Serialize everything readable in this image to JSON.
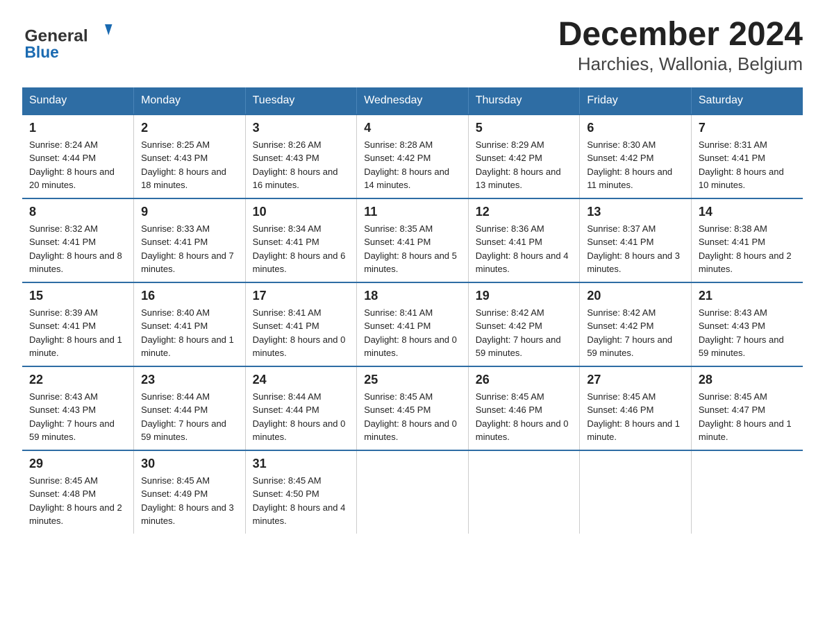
{
  "logo": {
    "general": "General",
    "blue": "Blue"
  },
  "title": "December 2024",
  "subtitle": "Harchies, Wallonia, Belgium",
  "days_of_week": [
    "Sunday",
    "Monday",
    "Tuesday",
    "Wednesday",
    "Thursday",
    "Friday",
    "Saturday"
  ],
  "weeks": [
    [
      {
        "day": "1",
        "sunrise": "8:24 AM",
        "sunset": "4:44 PM",
        "daylight": "8 hours and 20 minutes."
      },
      {
        "day": "2",
        "sunrise": "8:25 AM",
        "sunset": "4:43 PM",
        "daylight": "8 hours and 18 minutes."
      },
      {
        "day": "3",
        "sunrise": "8:26 AM",
        "sunset": "4:43 PM",
        "daylight": "8 hours and 16 minutes."
      },
      {
        "day": "4",
        "sunrise": "8:28 AM",
        "sunset": "4:42 PM",
        "daylight": "8 hours and 14 minutes."
      },
      {
        "day": "5",
        "sunrise": "8:29 AM",
        "sunset": "4:42 PM",
        "daylight": "8 hours and 13 minutes."
      },
      {
        "day": "6",
        "sunrise": "8:30 AM",
        "sunset": "4:42 PM",
        "daylight": "8 hours and 11 minutes."
      },
      {
        "day": "7",
        "sunrise": "8:31 AM",
        "sunset": "4:41 PM",
        "daylight": "8 hours and 10 minutes."
      }
    ],
    [
      {
        "day": "8",
        "sunrise": "8:32 AM",
        "sunset": "4:41 PM",
        "daylight": "8 hours and 8 minutes."
      },
      {
        "day": "9",
        "sunrise": "8:33 AM",
        "sunset": "4:41 PM",
        "daylight": "8 hours and 7 minutes."
      },
      {
        "day": "10",
        "sunrise": "8:34 AM",
        "sunset": "4:41 PM",
        "daylight": "8 hours and 6 minutes."
      },
      {
        "day": "11",
        "sunrise": "8:35 AM",
        "sunset": "4:41 PM",
        "daylight": "8 hours and 5 minutes."
      },
      {
        "day": "12",
        "sunrise": "8:36 AM",
        "sunset": "4:41 PM",
        "daylight": "8 hours and 4 minutes."
      },
      {
        "day": "13",
        "sunrise": "8:37 AM",
        "sunset": "4:41 PM",
        "daylight": "8 hours and 3 minutes."
      },
      {
        "day": "14",
        "sunrise": "8:38 AM",
        "sunset": "4:41 PM",
        "daylight": "8 hours and 2 minutes."
      }
    ],
    [
      {
        "day": "15",
        "sunrise": "8:39 AM",
        "sunset": "4:41 PM",
        "daylight": "8 hours and 1 minute."
      },
      {
        "day": "16",
        "sunrise": "8:40 AM",
        "sunset": "4:41 PM",
        "daylight": "8 hours and 1 minute."
      },
      {
        "day": "17",
        "sunrise": "8:41 AM",
        "sunset": "4:41 PM",
        "daylight": "8 hours and 0 minutes."
      },
      {
        "day": "18",
        "sunrise": "8:41 AM",
        "sunset": "4:41 PM",
        "daylight": "8 hours and 0 minutes."
      },
      {
        "day": "19",
        "sunrise": "8:42 AM",
        "sunset": "4:42 PM",
        "daylight": "7 hours and 59 minutes."
      },
      {
        "day": "20",
        "sunrise": "8:42 AM",
        "sunset": "4:42 PM",
        "daylight": "7 hours and 59 minutes."
      },
      {
        "day": "21",
        "sunrise": "8:43 AM",
        "sunset": "4:43 PM",
        "daylight": "7 hours and 59 minutes."
      }
    ],
    [
      {
        "day": "22",
        "sunrise": "8:43 AM",
        "sunset": "4:43 PM",
        "daylight": "7 hours and 59 minutes."
      },
      {
        "day": "23",
        "sunrise": "8:44 AM",
        "sunset": "4:44 PM",
        "daylight": "7 hours and 59 minutes."
      },
      {
        "day": "24",
        "sunrise": "8:44 AM",
        "sunset": "4:44 PM",
        "daylight": "8 hours and 0 minutes."
      },
      {
        "day": "25",
        "sunrise": "8:45 AM",
        "sunset": "4:45 PM",
        "daylight": "8 hours and 0 minutes."
      },
      {
        "day": "26",
        "sunrise": "8:45 AM",
        "sunset": "4:46 PM",
        "daylight": "8 hours and 0 minutes."
      },
      {
        "day": "27",
        "sunrise": "8:45 AM",
        "sunset": "4:46 PM",
        "daylight": "8 hours and 1 minute."
      },
      {
        "day": "28",
        "sunrise": "8:45 AM",
        "sunset": "4:47 PM",
        "daylight": "8 hours and 1 minute."
      }
    ],
    [
      {
        "day": "29",
        "sunrise": "8:45 AM",
        "sunset": "4:48 PM",
        "daylight": "8 hours and 2 minutes."
      },
      {
        "day": "30",
        "sunrise": "8:45 AM",
        "sunset": "4:49 PM",
        "daylight": "8 hours and 3 minutes."
      },
      {
        "day": "31",
        "sunrise": "8:45 AM",
        "sunset": "4:50 PM",
        "daylight": "8 hours and 4 minutes."
      },
      null,
      null,
      null,
      null
    ]
  ],
  "labels": {
    "sunrise": "Sunrise:",
    "sunset": "Sunset:",
    "daylight": "Daylight:"
  }
}
